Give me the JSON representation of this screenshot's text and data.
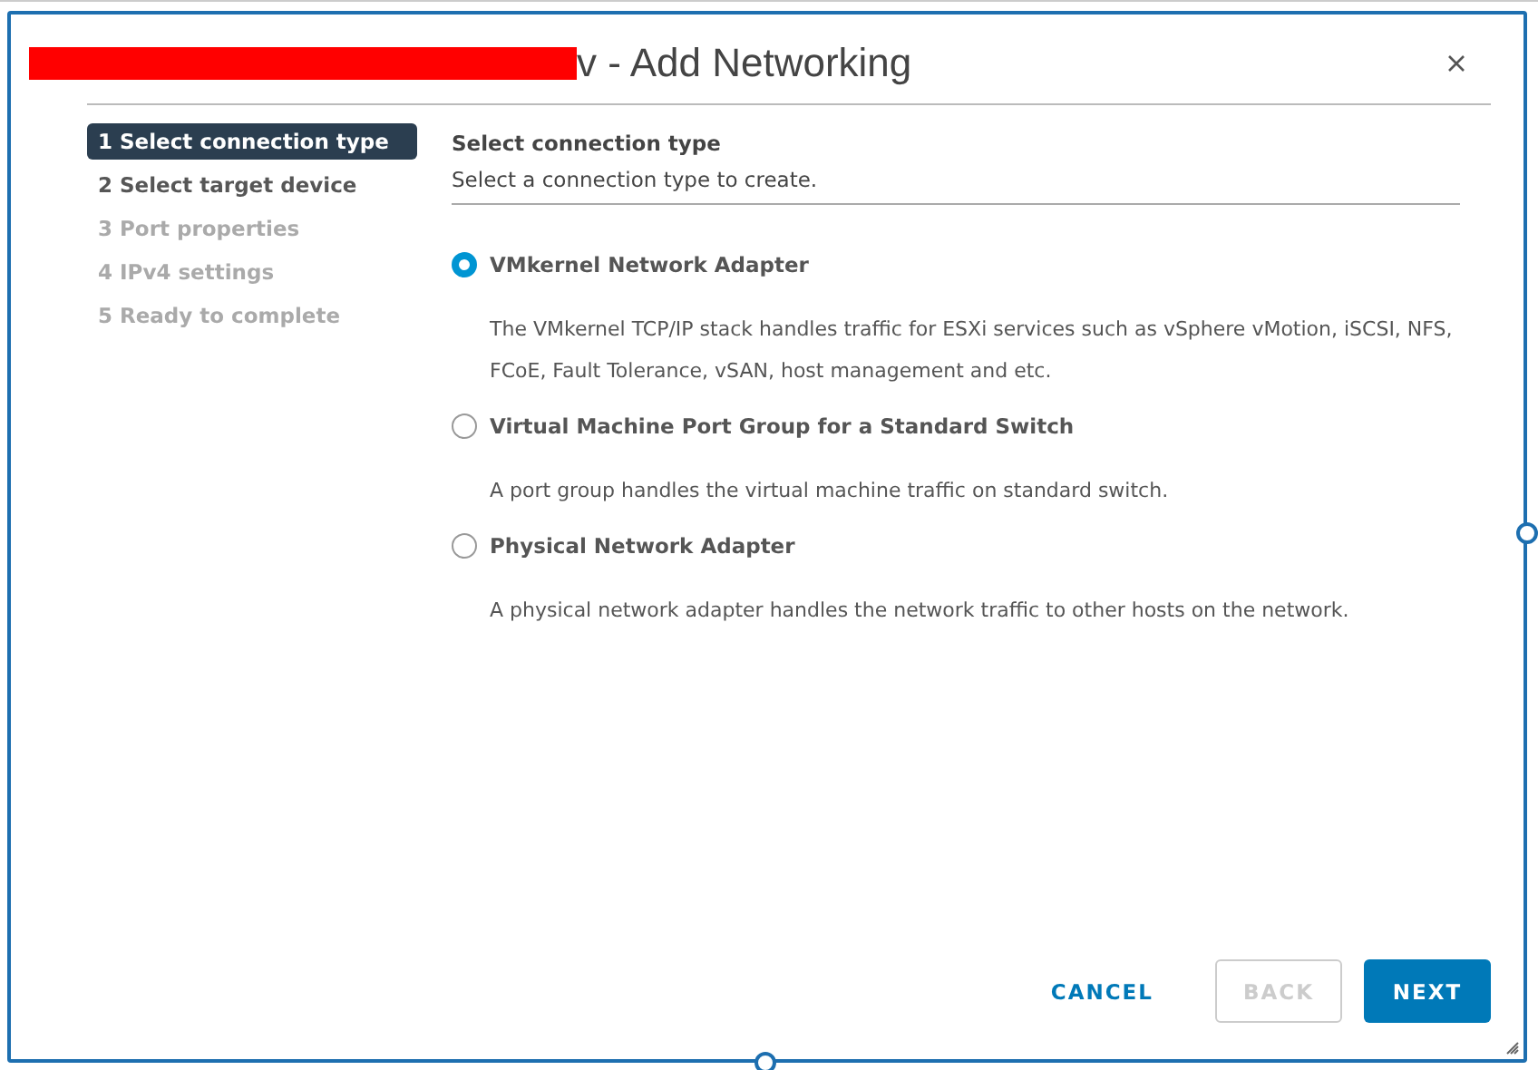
{
  "dialog": {
    "title": "v - Add Networking",
    "redacted": true
  },
  "steps": [
    {
      "label": "1 Select connection type",
      "selected": true,
      "disabled": false
    },
    {
      "label": "2 Select target device",
      "selected": false,
      "disabled": false
    },
    {
      "label": "3 Port properties",
      "selected": false,
      "disabled": true
    },
    {
      "label": "4 IPv4 settings",
      "selected": false,
      "disabled": true
    },
    {
      "label": "5 Ready to complete",
      "selected": false,
      "disabled": true
    }
  ],
  "page": {
    "heading": "Select connection type",
    "subheading": "Select a connection type to create."
  },
  "options": [
    {
      "label": "VMkernel Network Adapter",
      "selected": true,
      "description": "The VMkernel TCP/IP stack handles traffic for ESXi services such as vSphere vMotion, iSCSI, NFS, FCoE, Fault Tolerance, vSAN, host management and etc."
    },
    {
      "label": "Virtual Machine Port Group for a Standard Switch",
      "selected": false,
      "description": "A port group handles the virtual machine traffic on standard switch."
    },
    {
      "label": "Physical Network Adapter",
      "selected": false,
      "description": "A physical network adapter handles the network traffic to other hosts on the network."
    }
  ],
  "buttons": [
    {
      "label": "CANCEL",
      "kind": "flat",
      "disabled": false
    },
    {
      "label": "BACK",
      "kind": "outline",
      "disabled": true
    },
    {
      "label": "NEXT",
      "kind": "primary",
      "disabled": false
    }
  ]
}
